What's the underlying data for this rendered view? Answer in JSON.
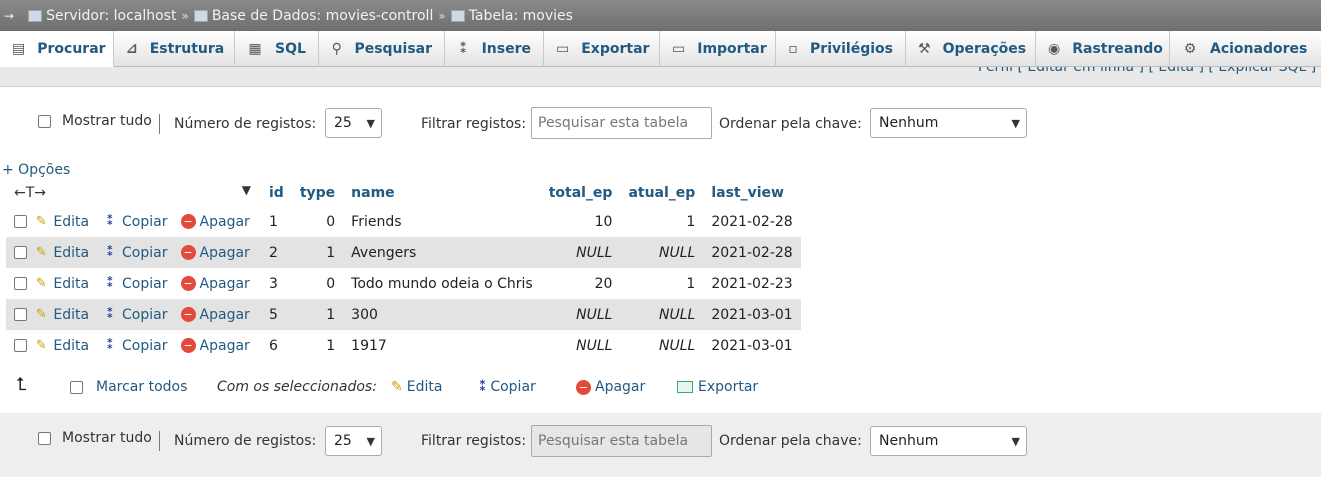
{
  "breadcrumb": {
    "server": "Servidor: localhost",
    "database": "Base de Dados: movies-controll",
    "table": "Tabela: movies",
    "sep": "»"
  },
  "menu": {
    "tabs": [
      {
        "label": "Procurar",
        "icon": "browse-icon"
      },
      {
        "label": "Estrutura",
        "icon": "structure-icon"
      },
      {
        "label": "SQL",
        "icon": "sql-icon"
      },
      {
        "label": "Pesquisar",
        "icon": "search-icon"
      },
      {
        "label": "Insere",
        "icon": "insert-icon"
      },
      {
        "label": "Exportar",
        "icon": "export-icon"
      },
      {
        "label": "Importar",
        "icon": "import-icon"
      },
      {
        "label": "Privilégios",
        "icon": "privileges-icon"
      },
      {
        "label": "Operações",
        "icon": "wrench-icon"
      },
      {
        "label": "Rastreando",
        "icon": "eye-icon"
      },
      {
        "label": "Acionadores",
        "icon": "triggers-icon"
      }
    ]
  },
  "strip_text": "Perfil [ Editar em linha ] [ Edita ] [ Explicar SQL ] [",
  "nav": {
    "show_all": "Mostrar tudo",
    "rows_label": "Número de registos:",
    "rows_value": "25",
    "filter_label": "Filtrar registos:",
    "filter_placeholder": "Pesquisar esta tabela",
    "sort_label": "Ordenar pela chave:",
    "sort_value": "Nenhum"
  },
  "options_link": "+ Opções",
  "table": {
    "columns": [
      "id",
      "type",
      "name",
      "total_ep",
      "atual_ep",
      "last_view"
    ],
    "actions": {
      "edit": "Edita",
      "copy": "Copiar",
      "delete": "Apagar"
    },
    "rows": [
      {
        "id": "1",
        "type": "0",
        "name": "Friends",
        "total_ep": "10",
        "atual_ep": "1",
        "last_view": "2021-02-28"
      },
      {
        "id": "2",
        "type": "1",
        "name": "Avengers",
        "total_ep": "NULL",
        "atual_ep": "NULL",
        "last_view": "2021-02-28"
      },
      {
        "id": "3",
        "type": "0",
        "name": "Todo mundo odeia o Chris",
        "total_ep": "20",
        "atual_ep": "1",
        "last_view": "2021-02-23"
      },
      {
        "id": "5",
        "type": "1",
        "name": "300",
        "total_ep": "NULL",
        "atual_ep": "NULL",
        "last_view": "2021-03-01"
      },
      {
        "id": "6",
        "type": "1",
        "name": "1917",
        "total_ep": "NULL",
        "atual_ep": "NULL",
        "last_view": "2021-03-01"
      }
    ]
  },
  "bulk": {
    "check_all": "Marcar todos",
    "with_selected": "Com os seleccionados:",
    "edit": "Edita",
    "copy": "Copiar",
    "delete": "Apagar",
    "export": "Exportar"
  }
}
